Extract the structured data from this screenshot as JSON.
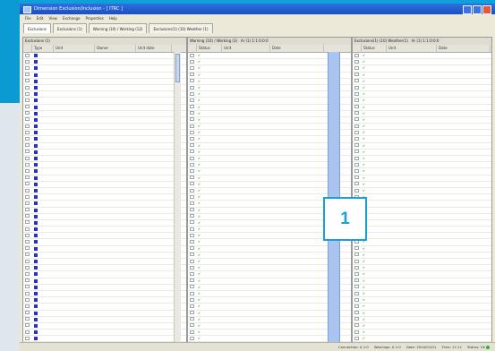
{
  "window": {
    "title": "Dimension Exclusion/Inclusion - [ ITRC ]"
  },
  "menu": {
    "items": [
      "File",
      "Edit",
      "View",
      "Exchange",
      "Properties",
      "Help"
    ]
  },
  "tabs": [
    {
      "label": "Exclusions"
    },
    {
      "label": "Exclusions (1)"
    },
    {
      "label": "Warning (10) / Working (12)"
    },
    {
      "label": "Exclusions(1) (10) Weather (1)"
    }
  ],
  "panes": {
    "left": {
      "title": "Exclusions (1)",
      "info": "",
      "columns": [
        "",
        "Type",
        "Unit",
        "Owner",
        "Unit date"
      ]
    },
    "middle": {
      "title": "Warning (10) / Working (3)",
      "info": "Ar (1) 1:1:0:0:0",
      "columns": [
        "",
        "Status",
        "Unit",
        "Date"
      ]
    },
    "right": {
      "title": "Exclusions(1) (10) Weather(1)",
      "info": "Ar (1) 1:1:0:0:0",
      "columns": [
        "",
        "Status",
        "Unit",
        "Date"
      ]
    }
  },
  "statusbar": {
    "fields": [
      "Connection: A 1:0",
      "Warnings: A 1:0",
      "Date: 2004/01/01",
      "Time: 11:11",
      "Status: Ok"
    ]
  },
  "callout": {
    "label": "1"
  },
  "colors": {
    "accent": "#1aa0d8",
    "titlebar": "#1c4fbf",
    "row_marker": "#2b34b4"
  }
}
